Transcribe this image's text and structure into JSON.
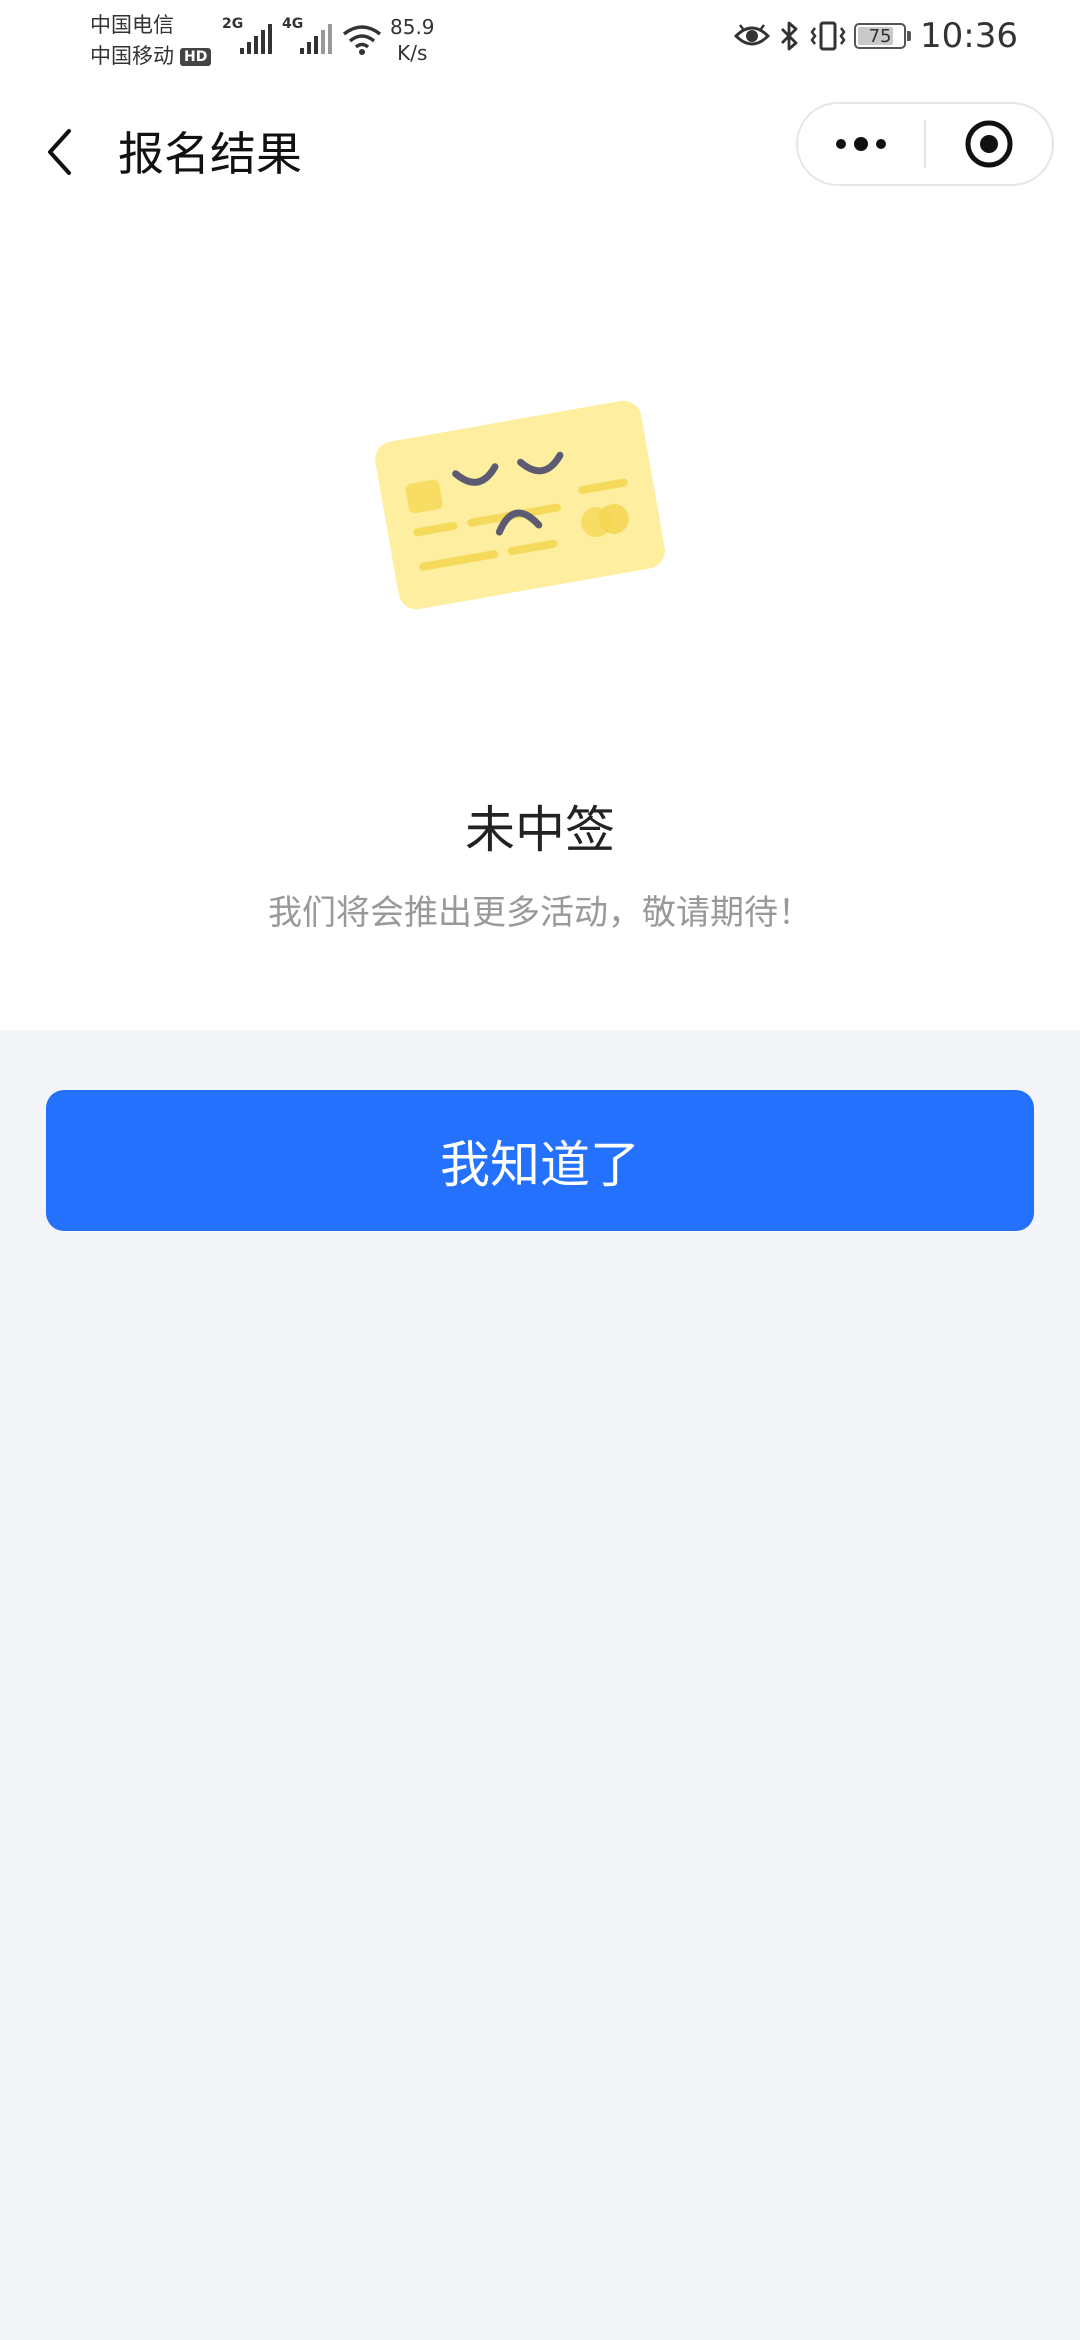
{
  "status_bar": {
    "carrier1": "中国电信",
    "carrier2": "中国移动",
    "hd_badge": "HD",
    "sig1_tag": "2G",
    "sig2_tag": "4G",
    "net_speed_value": "85.9",
    "net_speed_unit": "K/s",
    "battery": "75",
    "time": "10:36",
    "icons": [
      "eye-icon",
      "bluetooth-icon",
      "vibrate-icon",
      "battery-icon"
    ]
  },
  "navbar": {
    "title": "报名结果",
    "icons": [
      "back-arrow-icon",
      "more-dots-icon",
      "target-close-icon"
    ]
  },
  "result": {
    "title": "未中签",
    "subtitle": "我们将会推出更多活动，敬请期待！",
    "illustration": "sad-card-icon"
  },
  "actions": {
    "confirm_label": "我知道了"
  },
  "colors": {
    "accent": "#2371fc",
    "card": "#fdeea0",
    "face": "#5d5a73",
    "page_bg": "#f4f5f9"
  }
}
